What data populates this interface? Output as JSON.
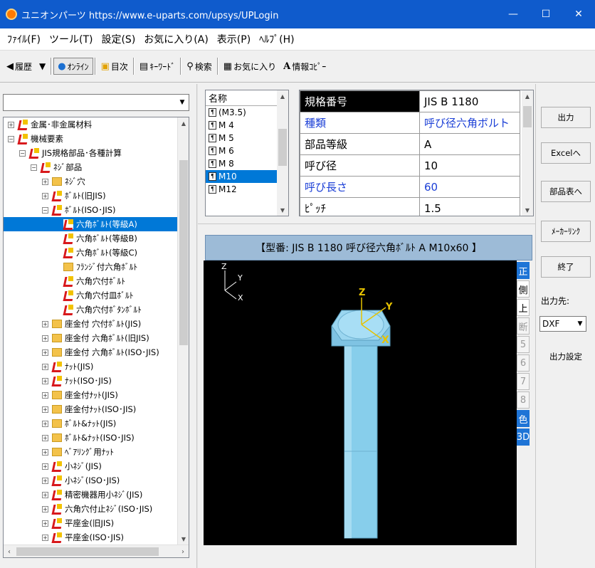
{
  "window": {
    "title": "ユニオンパーツ https://www.e-uparts.com/upsys/UPLogin",
    "minimize": "—",
    "maximize": "☐",
    "close": "✕"
  },
  "menu": [
    "ﾌｧｲﾙ(F)",
    "ツール(T)",
    "設定(S)",
    "お気に入り(A)",
    "表示(P)",
    "ﾍﾙﾌﾟ(H)"
  ],
  "toolbar": {
    "history": "履歴",
    "online": "ｵﾝﾗｲﾝ",
    "contents": "目次",
    "keyword": "ｷｰﾜｰﾄﾞ",
    "search": "検索",
    "favorites": "お気に入り",
    "copy_info": "情報ｺﾋﾟｰ"
  },
  "tree": {
    "combo_value": "",
    "nodes": [
      {
        "label": "金属･非金属材料",
        "indent": 0,
        "exp": "+",
        "icon": "red"
      },
      {
        "label": "機械要素",
        "indent": 0,
        "exp": "-",
        "icon": "red"
      },
      {
        "label": "JIS規格部品･各種計算",
        "indent": 1,
        "exp": "-",
        "icon": "red"
      },
      {
        "label": "ﾈｼﾞ部品",
        "indent": 2,
        "exp": "-",
        "icon": "red"
      },
      {
        "label": "ﾈｼﾞ穴",
        "indent": 3,
        "exp": "+",
        "icon": "folder"
      },
      {
        "label": "ﾎﾞﾙﾄ(旧JIS)",
        "indent": 3,
        "exp": "+",
        "icon": "red"
      },
      {
        "label": "ﾎﾞﾙﾄ(ISO･JIS)",
        "indent": 3,
        "exp": "-",
        "icon": "red"
      },
      {
        "label": "六角ﾎﾞﾙﾄ(等級A)",
        "indent": 4,
        "exp": "",
        "icon": "red",
        "selected": true
      },
      {
        "label": "六角ﾎﾞﾙﾄ(等級B)",
        "indent": 4,
        "exp": "",
        "icon": "red"
      },
      {
        "label": "六角ﾎﾞﾙﾄ(等級C)",
        "indent": 4,
        "exp": "",
        "icon": "red"
      },
      {
        "label": "ﾌﾗﾝｼﾞ付六角ﾎﾞﾙﾄ",
        "indent": 4,
        "exp": "",
        "icon": "folder"
      },
      {
        "label": "六角穴付ﾎﾞﾙﾄ",
        "indent": 4,
        "exp": "",
        "icon": "red"
      },
      {
        "label": "六角穴付皿ﾎﾞﾙﾄ",
        "indent": 4,
        "exp": "",
        "icon": "red"
      },
      {
        "label": "六角穴付ﾎﾞﾀﾝﾎﾞﾙﾄ",
        "indent": 4,
        "exp": "",
        "icon": "red"
      },
      {
        "label": "座金付 穴付ﾎﾞﾙﾄ(JIS)",
        "indent": 3,
        "exp": "+",
        "icon": "folder"
      },
      {
        "label": "座金付 六角ﾎﾞﾙﾄ(旧JIS)",
        "indent": 3,
        "exp": "+",
        "icon": "folder"
      },
      {
        "label": "座金付 六角ﾎﾞﾙﾄ(ISO･JIS)",
        "indent": 3,
        "exp": "+",
        "icon": "folder"
      },
      {
        "label": "ﾅｯﾄ(JIS)",
        "indent": 3,
        "exp": "+",
        "icon": "red"
      },
      {
        "label": "ﾅｯﾄ(ISO･JIS)",
        "indent": 3,
        "exp": "+",
        "icon": "red"
      },
      {
        "label": "座金付ﾅｯﾄ(JIS)",
        "indent": 3,
        "exp": "+",
        "icon": "folder"
      },
      {
        "label": "座金付ﾅｯﾄ(ISO･JIS)",
        "indent": 3,
        "exp": "+",
        "icon": "folder"
      },
      {
        "label": "ﾎﾞﾙﾄ&ﾅｯﾄ(JIS)",
        "indent": 3,
        "exp": "+",
        "icon": "folder"
      },
      {
        "label": "ﾎﾞﾙﾄ&ﾅｯﾄ(ISO･JIS)",
        "indent": 3,
        "exp": "+",
        "icon": "folder"
      },
      {
        "label": "ﾍﾞｱﾘﾝｸﾞ用ﾅｯﾄ",
        "indent": 3,
        "exp": "+",
        "icon": "folder"
      },
      {
        "label": "小ﾈｼﾞ(JIS)",
        "indent": 3,
        "exp": "+",
        "icon": "red"
      },
      {
        "label": "小ﾈｼﾞ(ISO･JIS)",
        "indent": 3,
        "exp": "+",
        "icon": "red"
      },
      {
        "label": "精密機器用小ﾈｼﾞ(JIS)",
        "indent": 3,
        "exp": "+",
        "icon": "red"
      },
      {
        "label": "六角穴付止ﾈｼﾞ(ISO･JIS)",
        "indent": 3,
        "exp": "+",
        "icon": "red"
      },
      {
        "label": "平座金(旧JIS)",
        "indent": 3,
        "exp": "+",
        "icon": "red"
      },
      {
        "label": "平座金(ISO･JIS)",
        "indent": 3,
        "exp": "+",
        "icon": "red"
      }
    ]
  },
  "sizes": {
    "header": "名称",
    "items": [
      "(M3.5)",
      "M 4",
      "M 5",
      "M 6",
      "M 8",
      "M10",
      "M12"
    ],
    "selected": "M10"
  },
  "spec": {
    "rows": [
      {
        "key": "規格番号",
        "value": "JIS B 1180",
        "style": "header"
      },
      {
        "key": "種類",
        "value": "呼び径六角ボルト",
        "style": "blue"
      },
      {
        "key": "部品等級",
        "value": "A",
        "style": "normal"
      },
      {
        "key": "呼び径",
        "value": "10",
        "style": "normal"
      },
      {
        "key": "呼び長さ",
        "value": "60",
        "style": "blue"
      },
      {
        "key": "ﾋﾟｯﾁ",
        "value": "1.5",
        "style": "normal"
      }
    ]
  },
  "model": {
    "caption": "【型番: JIS B 1180 呼び径六角ﾎﾞﾙﾄ A M10x60 】",
    "axis_z": "Z",
    "axis_y": "Y",
    "axis_x": "X",
    "bolt_z": "Z",
    "bolt_y": "Y",
    "bolt_x": "X",
    "bolt_color": "#87ceeb"
  },
  "view_tabs": [
    {
      "label": "正",
      "state": "on"
    },
    {
      "label": "側",
      "state": "normal"
    },
    {
      "label": "上",
      "state": "normal"
    },
    {
      "label": "断",
      "state": "dim"
    },
    {
      "label": "5",
      "state": "dim"
    },
    {
      "label": "6",
      "state": "dim"
    },
    {
      "label": "7",
      "state": "dim"
    },
    {
      "label": "8",
      "state": "dim"
    },
    {
      "label": "色",
      "state": "on"
    },
    {
      "label": "3D",
      "state": "on"
    }
  ],
  "actions": {
    "output": "出力",
    "excel": "Excelへ",
    "parts_table": "部品表へ",
    "maker_link": "ﾒｰｶｰﾘﾝｸ",
    "exit": "終了",
    "output_dest_label": "出力先:",
    "output_dest_value": "DXF",
    "output_settings": "出力設定"
  }
}
